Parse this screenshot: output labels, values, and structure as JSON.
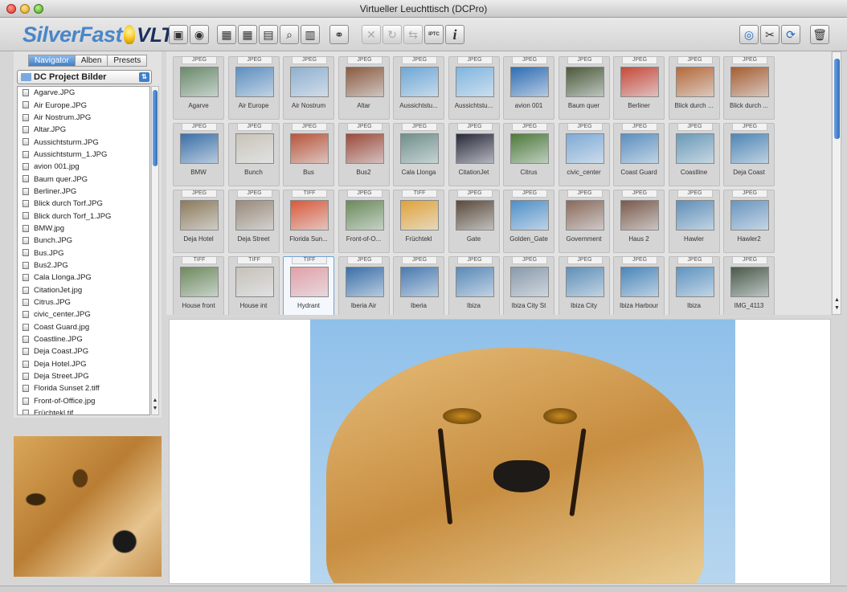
{
  "window": {
    "title": "Virtueller Leuchttisch (DCPro)"
  },
  "logo": {
    "text_main": "SilverFast",
    "text_suffix": "VLT"
  },
  "toolbar": {
    "buttons": [
      {
        "name": "save-icon",
        "glyph": "▣"
      },
      {
        "name": "scan-icon",
        "glyph": "◉"
      },
      {
        "name": "grid-large-icon",
        "glyph": "▦"
      },
      {
        "name": "grid-small-icon",
        "glyph": "▦"
      },
      {
        "name": "photo-icon",
        "glyph": "▤"
      },
      {
        "name": "magnifier-icon",
        "glyph": "⌕"
      },
      {
        "name": "compare-icon",
        "glyph": "▥"
      },
      {
        "name": "binoculars-icon",
        "glyph": "⚭"
      },
      {
        "name": "delete-x-icon",
        "glyph": "✕"
      },
      {
        "name": "rotate-icon",
        "glyph": "↻"
      },
      {
        "name": "flip-icon",
        "glyph": "⇆"
      },
      {
        "name": "iptc-icon",
        "glyph": "IPTC"
      },
      {
        "name": "info-icon",
        "glyph": "i"
      },
      {
        "name": "print-icon",
        "glyph": "◎"
      },
      {
        "name": "tools-icon",
        "glyph": "✂"
      },
      {
        "name": "sync-icon",
        "glyph": "⟳"
      },
      {
        "name": "trash-icon",
        "glyph": "🗑"
      }
    ]
  },
  "left": {
    "tabs": [
      "Navigator",
      "Alben",
      "Presets"
    ],
    "folder": "DC Project Bilder",
    "files": [
      "Agarve.JPG",
      "Air Europe.JPG",
      "Air Nostrum.JPG",
      "Altar.JPG",
      "Aussichtsturm.JPG",
      "Aussichtsturm_1.JPG",
      "avion 001.jpg",
      "Baum quer.JPG",
      "Berliner.JPG",
      "Blick durch Torf.JPG",
      "Blick durch Torf_1.JPG",
      "BMW.jpg",
      "Bunch.JPG",
      "Bus.JPG",
      "Bus2.JPG",
      "Cala Llonga.JPG",
      "CitationJet.jpg",
      "Citrus.JPG",
      "civic_center.JPG",
      "Coast Guard.jpg",
      "Coastline.JPG",
      "Deja Coast.JPG",
      "Deja Hotel.JPG",
      "Deja Street.JPG",
      "Florida Sunset 2.tiff",
      "Front-of-Office.jpg",
      "Früchtekl.tif"
    ]
  },
  "grid": {
    "rows": [
      [
        {
          "type": "JPEG",
          "name": "Agarve",
          "color": "#6b8a6a"
        },
        {
          "type": "JPEG",
          "name": "Air Europe",
          "color": "#5d8fbf"
        },
        {
          "type": "JPEG",
          "name": "Air Nostrum",
          "color": "#8fb0cf"
        },
        {
          "type": "JPEG",
          "name": "Altar",
          "color": "#8a5b3f"
        },
        {
          "type": "JPEG",
          "name": "Aussichtstu...",
          "color": "#6ea7d6"
        },
        {
          "type": "JPEG",
          "name": "Aussichtstu...",
          "color": "#7fb6df"
        },
        {
          "type": "JPEG",
          "name": "avion 001",
          "color": "#2f6db3"
        },
        {
          "type": "JPEG",
          "name": "Baum quer",
          "color": "#4c5a3a"
        },
        {
          "type": "JPEG",
          "name": "Berliner",
          "color": "#c64a3a"
        },
        {
          "type": "JPEG",
          "name": "Blick durch ...",
          "color": "#b56a3a"
        },
        {
          "type": "JPEG",
          "name": "Blick durch ...",
          "color": "#a65e32"
        }
      ],
      [
        {
          "type": "JPEG",
          "name": "BMW",
          "color": "#3b6fa8"
        },
        {
          "type": "JPEG",
          "name": "Bunch",
          "color": "#c9c4b8"
        },
        {
          "type": "JPEG",
          "name": "Bus",
          "color": "#b9553a"
        },
        {
          "type": "JPEG",
          "name": "Bus2",
          "color": "#9c4a3a"
        },
        {
          "type": "JPEG",
          "name": "Cala Llonga",
          "color": "#6f8f8a"
        },
        {
          "type": "JPEG",
          "name": "CitationJet",
          "color": "#2a2a3a"
        },
        {
          "type": "JPEG",
          "name": "Citrus",
          "color": "#4e7a3a"
        },
        {
          "type": "JPEG",
          "name": "civic_center",
          "color": "#7faad6"
        },
        {
          "type": "JPEG",
          "name": "Coast Guard",
          "color": "#5b8fbf"
        },
        {
          "type": "JPEG",
          "name": "Coastline",
          "color": "#6a9ab8"
        },
        {
          "type": "JPEG",
          "name": "Deja Coast",
          "color": "#4f86b5"
        }
      ],
      [
        {
          "type": "JPEG",
          "name": "Deja Hotel",
          "color": "#8c7a5a"
        },
        {
          "type": "JPEG",
          "name": "Deja Street",
          "color": "#9a8a7a"
        },
        {
          "type": "TIFF",
          "name": "Florida Sun...",
          "color": "#d85a3a"
        },
        {
          "type": "JPEG",
          "name": "Front-of-O...",
          "color": "#6b8a5a"
        },
        {
          "type": "TIFF",
          "name": "Früchtekl",
          "color": "#e0a23a"
        },
        {
          "type": "JPEG",
          "name": "Gate",
          "color": "#5a4a3a"
        },
        {
          "type": "JPEG",
          "name": "Golden_Gate",
          "color": "#4f8fc8"
        },
        {
          "type": "JPEG",
          "name": "Government",
          "color": "#8a6a5a"
        },
        {
          "type": "JPEG",
          "name": "Haus 2",
          "color": "#7a5a4a"
        },
        {
          "type": "JPEG",
          "name": "Hawler",
          "color": "#5f8fb8"
        },
        {
          "type": "JPEG",
          "name": "Hawler2",
          "color": "#6a96bf"
        }
      ],
      [
        {
          "type": "TIFF",
          "name": "House front",
          "color": "#6f8a5f",
          "selected": false
        },
        {
          "type": "TIFF",
          "name": "House int",
          "color": "#c7c1b8",
          "selected": false
        },
        {
          "type": "TIFF",
          "name": "Hydrant",
          "color": "#e2a0a8",
          "selected": true
        },
        {
          "type": "JPEG",
          "name": "Iberia Air",
          "color": "#3b6fa8"
        },
        {
          "type": "JPEG",
          "name": "Iberia",
          "color": "#4a7ab0"
        },
        {
          "type": "JPEG",
          "name": "Ibiza",
          "color": "#5a8ab8"
        },
        {
          "type": "JPEG",
          "name": "Ibiza City St",
          "color": "#8a9aaa"
        },
        {
          "type": "JPEG",
          "name": "Ibiza City",
          "color": "#5f8fb8"
        },
        {
          "type": "JPEG",
          "name": "Ibiza Harbour",
          "color": "#4a86b8"
        },
        {
          "type": "JPEG",
          "name": "Ibiza",
          "color": "#5f94c0"
        },
        {
          "type": "JPEG",
          "name": "IMG_4113",
          "color": "#4a5a4a"
        }
      ]
    ]
  },
  "preview": {
    "subject": "Cheetah portrait"
  }
}
